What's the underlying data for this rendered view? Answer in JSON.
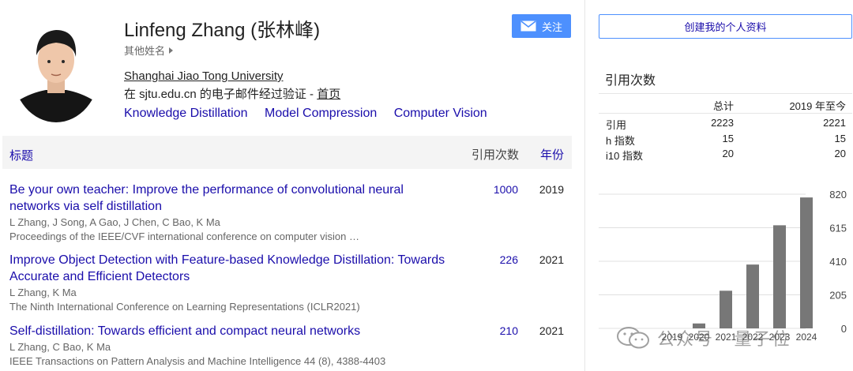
{
  "profile": {
    "name": "Linfeng Zhang (张林峰)",
    "other_names": "其他姓名",
    "affiliation": "Shanghai Jiao Tong University",
    "verified_prefix": "在 sjtu.edu.cn 的电子邮件经过验证 - ",
    "homepage": "首页",
    "topics": [
      "Knowledge Distillation",
      "Model Compression",
      "Computer Vision"
    ],
    "follow_label": "关注"
  },
  "table": {
    "title_header": "标题",
    "cited_header": "引用次数",
    "year_header": "年份"
  },
  "publications": [
    {
      "title": "Be your own teacher: Improve the performance of convolutional neural networks via self distillation",
      "authors": "L Zhang, J Song, A Gao, J Chen, C Bao, K Ma",
      "venue": "Proceedings of the IEEE/CVF international conference on computer vision …",
      "cited": "1000",
      "year": "2019"
    },
    {
      "title": "Improve Object Detection with Feature-based Knowledge Distillation: Towards Accurate and Efficient Detectors",
      "authors": "L Zhang, K Ma",
      "venue": "The Ninth International Conference on Learning Representations (ICLR2021)",
      "cited": "226",
      "year": "2021"
    },
    {
      "title": "Self-distillation: Towards efficient and compact neural networks",
      "authors": "L Zhang, C Bao, K Ma",
      "venue": "IEEE Transactions on Pattern Analysis and Machine Intelligence 44 (8), 4388-4403",
      "cited": "210",
      "year": "2021"
    }
  ],
  "sidebar": {
    "create_profile": "创建我的个人资料",
    "cited_by": "引用次数",
    "col_all": "总计",
    "col_since": "2019 年至今",
    "rows": [
      {
        "label": "引用",
        "all": "2223",
        "since": "2221"
      },
      {
        "label": "h 指数",
        "all": "15",
        "since": "15"
      },
      {
        "label": "i10 指数",
        "all": "20",
        "since": "20"
      }
    ]
  },
  "chart_data": {
    "type": "bar",
    "categories": [
      "2019",
      "2020",
      "2021",
      "2022",
      "2023",
      "2024"
    ],
    "values": [
      0,
      30,
      230,
      390,
      630,
      800
    ],
    "yticks": [
      "820",
      "615",
      "410",
      "205",
      "0"
    ],
    "ylim": [
      0,
      820
    ],
    "bar_color": "#777777",
    "grid": true
  },
  "watermark": {
    "text": "公众号 · 量子位"
  },
  "colors": {
    "link": "#1a0dab",
    "button": "#4d90fe"
  }
}
